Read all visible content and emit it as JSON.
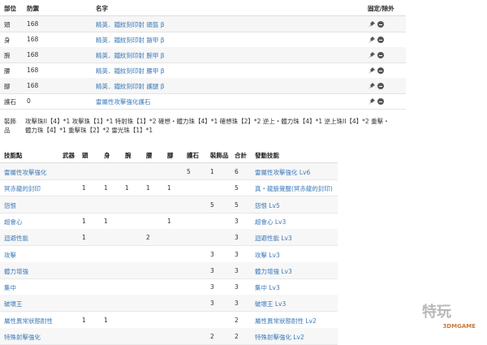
{
  "equipment": {
    "headers": {
      "part": "部位",
      "defense": "防禦",
      "name": "名字",
      "actions": "固定/除外"
    },
    "rows": [
      {
        "part": "頭",
        "defense": "168",
        "name": "精英．鐵紋刻印射 頭盔 β"
      },
      {
        "part": "身",
        "defense": "168",
        "name": "精英．鐵紋刻印射 鎧甲 β"
      },
      {
        "part": "腕",
        "defense": "168",
        "name": "精英．鐵紋刻印射 腕甲 β"
      },
      {
        "part": "腰",
        "defense": "168",
        "name": "精英．鐵紋刻印射 腰甲 β"
      },
      {
        "part": "腳",
        "defense": "168",
        "name": "精英．鐵紋刻印射 護腿 β"
      },
      {
        "part": "護石",
        "defense": "0",
        "name": "雷屬性攻擊強化護石"
      }
    ]
  },
  "decorations": {
    "label": "裝飾品",
    "text": "攻擊珠II【4】*1 攻擊珠【1】*1 特射珠【1】*2 確想・體力珠【4】*1 確想珠【2】*2 逆上・體力珠【4】*1 逆上珠II【4】*2 重擊・體力珠【4】*1 重擊珠【2】*2 雷光珠【1】*1"
  },
  "skills": {
    "headers": {
      "name": "技能點",
      "weapon": "武器",
      "head": "頭",
      "body": "身",
      "arms": "腕",
      "waist": "腰",
      "legs": "腳",
      "charm": "護石",
      "deco": "裝飾品",
      "total": "合計",
      "active": "發動技能"
    },
    "rows": [
      {
        "name": "雷屬性攻擊強化",
        "weapon": "",
        "head": "",
        "body": "",
        "arms": "",
        "waist": "",
        "legs": "",
        "charm": "5",
        "deco": "1",
        "total": "6",
        "active": "雷屬性攻擊強化 Lv6"
      },
      {
        "name": "冥赤龍的封印",
        "weapon": "",
        "head": "1",
        "body": "1",
        "arms": "1",
        "waist": "1",
        "legs": "1",
        "charm": "",
        "deco": "",
        "total": "5",
        "active": "真・龍脈覺醒(冥赤龍的封印)"
      },
      {
        "name": "怨恨",
        "weapon": "",
        "head": "",
        "body": "",
        "arms": "",
        "waist": "",
        "legs": "",
        "charm": "",
        "deco": "5",
        "total": "5",
        "active": "怨恨 Lv5"
      },
      {
        "name": "超會心",
        "weapon": "",
        "head": "1",
        "body": "1",
        "arms": "",
        "waist": "",
        "legs": "1",
        "charm": "",
        "deco": "",
        "total": "3",
        "active": "超會心 Lv3"
      },
      {
        "name": "迴避性能",
        "weapon": "",
        "head": "1",
        "body": "",
        "arms": "",
        "waist": "2",
        "legs": "",
        "charm": "",
        "deco": "",
        "total": "3",
        "active": "迴避性能 Lv3"
      },
      {
        "name": "攻擊",
        "weapon": "",
        "head": "",
        "body": "",
        "arms": "",
        "waist": "",
        "legs": "",
        "charm": "",
        "deco": "3",
        "total": "3",
        "active": "攻擊 Lv3"
      },
      {
        "name": "體力增強",
        "weapon": "",
        "head": "",
        "body": "",
        "arms": "",
        "waist": "",
        "legs": "",
        "charm": "",
        "deco": "3",
        "total": "3",
        "active": "體力增強 Lv3"
      },
      {
        "name": "集中",
        "weapon": "",
        "head": "",
        "body": "",
        "arms": "",
        "waist": "",
        "legs": "",
        "charm": "",
        "deco": "3",
        "total": "3",
        "active": "集中 Lv3"
      },
      {
        "name": "破壞王",
        "weapon": "",
        "head": "",
        "body": "",
        "arms": "",
        "waist": "",
        "legs": "",
        "charm": "",
        "deco": "3",
        "total": "3",
        "active": "破壞王 Lv3"
      },
      {
        "name": "屬性異常狀態耐性",
        "weapon": "",
        "head": "1",
        "body": "1",
        "arms": "",
        "waist": "",
        "legs": "",
        "charm": "",
        "deco": "",
        "total": "2",
        "active": "屬性異常狀態耐性 Lv2"
      },
      {
        "name": "特殊射擊強化",
        "weapon": "",
        "head": "",
        "body": "",
        "arms": "",
        "waist": "",
        "legs": "",
        "charm": "",
        "deco": "2",
        "total": "2",
        "active": "特殊射擊強化 Lv2"
      }
    ]
  },
  "watermark": {
    "main": "特玩",
    "sub": "3DMGAME"
  }
}
